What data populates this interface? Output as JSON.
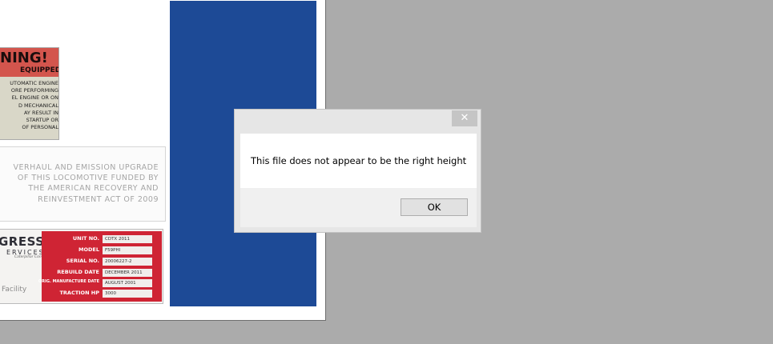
{
  "warning_sign": {
    "title": "NING!",
    "subtitle": "EQUIPPED",
    "lines": [
      "UTOMATIC ENGINE",
      "ORE PERFORMING",
      "EL ENGINE OR ON",
      "D MECHANICAL",
      "AY RESULT IN",
      "STARTUP OR",
      "OF PERSONAL"
    ]
  },
  "overhaul_plaque": {
    "lines": [
      "VERHAUL AND EMISSION UPGRADE",
      "OF THIS LOCOMOTIVE FUNDED BY",
      "THE AMERICAN RECOVERY AND",
      "REINVESTMENT ACT OF 2009"
    ]
  },
  "progress_plate": {
    "logo": "GRESS",
    "logo_sub": "ERVICES",
    "logo_tag": "Caterpillar Company",
    "facility": "Facility",
    "rows": [
      {
        "label": "UNIT NO.",
        "value": "CDTX 2011"
      },
      {
        "label": "MODEL",
        "value": "F59PHI"
      },
      {
        "label": "SERIAL NO.",
        "value": "20006227-2"
      },
      {
        "label": "REBUILD DATE",
        "value": "DECEMBER 2011"
      },
      {
        "label": "ORIG. MANUFACTURE DATE",
        "value": "AUGUST 2001"
      },
      {
        "label": "TRACTION HP",
        "value": "3000"
      }
    ]
  },
  "dialog": {
    "close_glyph": "✕",
    "message": "This file does not appear to be the right height",
    "ok_label": "OK"
  },
  "colors": {
    "desktop": "#ababab",
    "blue_panel": "#1d4a96",
    "plate_red": "#cf2434",
    "warning_red": "#d3554d"
  }
}
